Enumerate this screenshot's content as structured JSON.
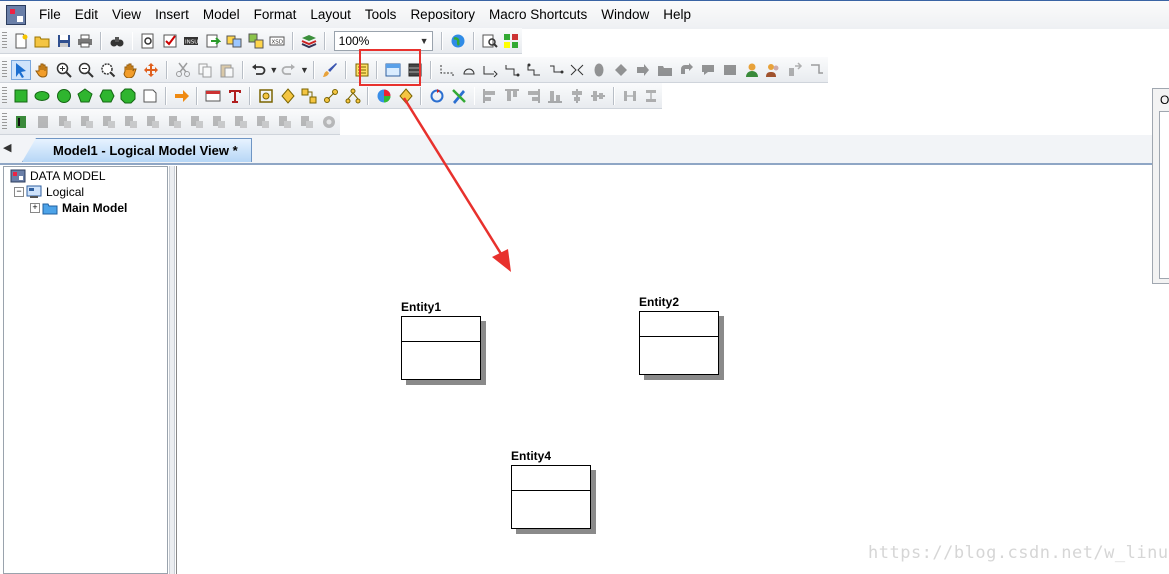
{
  "menu": {
    "items": [
      "File",
      "Edit",
      "View",
      "Insert",
      "Model",
      "Format",
      "Layout",
      "Tools",
      "Repository",
      "Macro Shortcuts",
      "Window",
      "Help"
    ]
  },
  "toolbar": {
    "zoom_value": "100%"
  },
  "tabs": {
    "active_label": "Model1 - Logical Model View *"
  },
  "tree": {
    "root_label": "DATA MODEL",
    "logical_label": "Logical",
    "main_model_label": "Main Model"
  },
  "canvas": {
    "entities": [
      {
        "name": "Entity1"
      },
      {
        "name": "Entity2"
      },
      {
        "name": "Entity4"
      }
    ]
  },
  "side_panel": {
    "label": "O"
  },
  "watermark": "https://blog.csdn.net/w_linux",
  "colors": {
    "highlight": "#e8312d",
    "tab_active": "#b6d6f6",
    "entity_shadow": "#8a8a8a"
  }
}
